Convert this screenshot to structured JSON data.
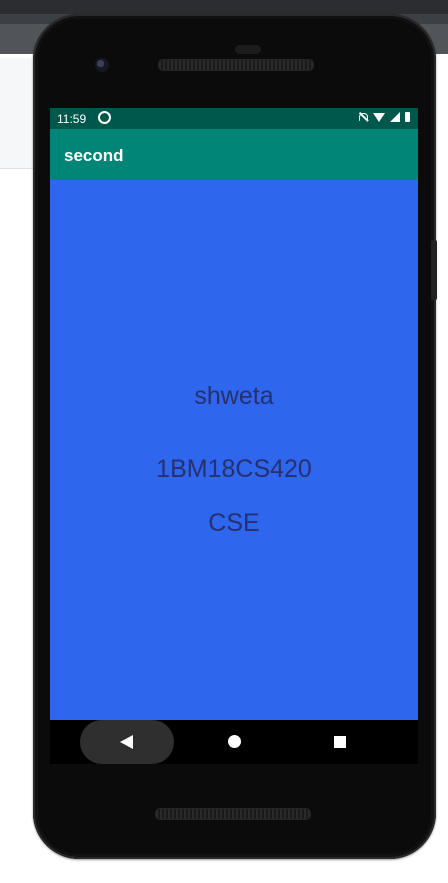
{
  "status_bar": {
    "time": "11:59"
  },
  "app_bar": {
    "title": "second"
  },
  "content": {
    "name": "shweta",
    "usn": "1BM18CS420",
    "branch": "CSE"
  },
  "colors": {
    "status_bar": "#00574b",
    "app_bar": "#008577",
    "screen_background": "#2e66ee",
    "content_text": "#27306e"
  },
  "icons": [
    "sync-icon",
    "notifications-off-icon",
    "wifi-icon",
    "signal-icon",
    "battery-icon",
    "back-icon",
    "home-icon",
    "recents-icon"
  ]
}
